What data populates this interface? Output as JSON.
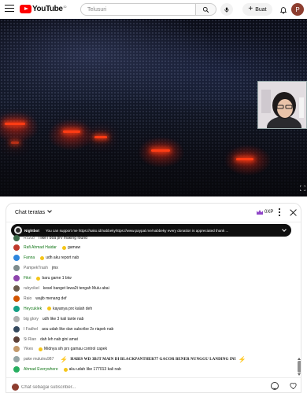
{
  "masthead": {
    "logo_text": "YouTube",
    "region_code": "ID",
    "search_placeholder": "Telusuri",
    "create_label": "Buat",
    "account_initial": "P",
    "icons": [
      "hamburger-icon",
      "search-icon",
      "mic-icon",
      "plus-icon",
      "bell-icon"
    ]
  },
  "chat": {
    "title": "Chat teratas",
    "points": "0XP",
    "pinned": {
      "author": "Nightbot",
      "text": "You can support me https://sako.id/nabbekyhttps://www.paypal.me/nabbeky every donation is appreciated thank ..."
    },
    "messages": [
      {
        "author": "RIS0b",
        "text": "i like i boa prv making found",
        "avatar": "#3d6b4b",
        "member": false
      },
      {
        "author": "Rafi Ahmad Haidar",
        "text": "gamaw",
        "avatar": "#c0392b",
        "member": true,
        "emoji": true
      },
      {
        "author": "Fanna",
        "text": "udh aku report nab",
        "avatar": "#2e86de",
        "member": true,
        "emoji": true
      },
      {
        "author": "PampekTrash",
        "text": "jmx",
        "avatar": "#7f8c8d",
        "member": false
      },
      {
        "author": "Fikri",
        "text": "baru game 1 btw",
        "avatar": "#8e44ad",
        "member": true,
        "emoji": true
      },
      {
        "author": "rubycikel",
        "text": "kesel banget lewa2t tengah Mulu abai",
        "avatar": "#6b5b4b",
        "member": false
      },
      {
        "author": "Raio",
        "text": "wajib menang def",
        "avatar": "#d35400",
        "member": false
      },
      {
        "author": "Heycuklek",
        "text": "kayanya prx kalah deh",
        "avatar": "#16a085",
        "member": true,
        "emoji": true
      },
      {
        "author": "big glory",
        "text": "udh like 3 kali tante nab",
        "avatar": "#b0b0b0",
        "member": false
      },
      {
        "author": "I Fadhel",
        "text": "aou udah like dan subcribe 2x riapek nab",
        "avatar": "#34495e",
        "member": false
      },
      {
        "author": "Si Rian",
        "text": "dah leh nab gini amat",
        "avatar": "#5d4037",
        "member": false
      },
      {
        "author": "Yikes",
        "text": "Midnya sih prx gamau control capek",
        "avatar": "#c49a6c",
        "member": false,
        "emoji": true
      },
      {
        "author": "pake mulutnu987",
        "text": "HABIS WD 3BJT MAIN DI BLACKPANTHER77 GACOR BENER NUNGGU LANDING INI",
        "avatar": "#95a5a6",
        "member": false,
        "big": true
      },
      {
        "author": "Ahmad Everywhere",
        "text": "aku udah like 177013 kali nab",
        "avatar": "#27ae60",
        "member": true,
        "emoji": true
      }
    ],
    "input_placeholder": "Chat sebagai subscriber...",
    "icons": [
      "crown-icon",
      "more-vert-icon",
      "close-icon",
      "emoji-icon",
      "heart-icon"
    ]
  },
  "colors": {
    "brand_red": "#ff0000",
    "member_green": "#107516",
    "points_purple": "#8e44c7",
    "account_bg": "#8d3d2f"
  }
}
